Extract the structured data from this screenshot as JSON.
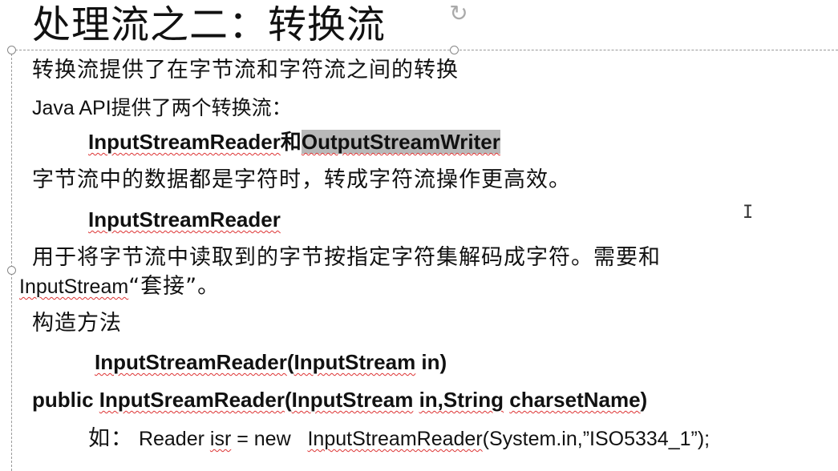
{
  "slide": {
    "title": "处理流之二：转换流",
    "lines": {
      "l1": "转换流提供了在字节流和字符流之间的转换",
      "l2": "Java API提供了两个转换流：",
      "l3a": "InputStreamReader",
      "l3b": "和",
      "l3c": "OutputStreamWriter",
      "l4": "字节流中的数据都是字符时，转成字符流操作更高效。",
      "l5": "InputStreamReader",
      "l6": "用于将字节流中读取到的字节按指定字符集解码成字符。需要和",
      "l7a": "InputStream",
      "l7b": "“套接”。",
      "l8": "构造方法",
      "l9a": "InputStreamReader",
      "l9b": "(",
      "l9c": "InputStream",
      "l9d": " in)",
      "l10a": "public ",
      "l10b": "InputSreamReader",
      "l10c": "(",
      "l10d": "InputStream",
      "l10e": " ",
      "l10f": "in,String",
      "l10g": " ",
      "l10h": "charsetName",
      "l10i": ")",
      "l11a": "如：",
      "l11b": " Reader ",
      "l11c": "isr",
      "l11d": " = new   ",
      "l11e": "InputStreamReader",
      "l11f": "(System.in,”ISO5334_1”);"
    }
  },
  "colors": {
    "selection_highlight": "#b8b8b8",
    "spellcheck_underline": "#d33"
  },
  "icons": {
    "rotate": "rotate-handle-icon",
    "cursor": "text-cursor-icon"
  }
}
